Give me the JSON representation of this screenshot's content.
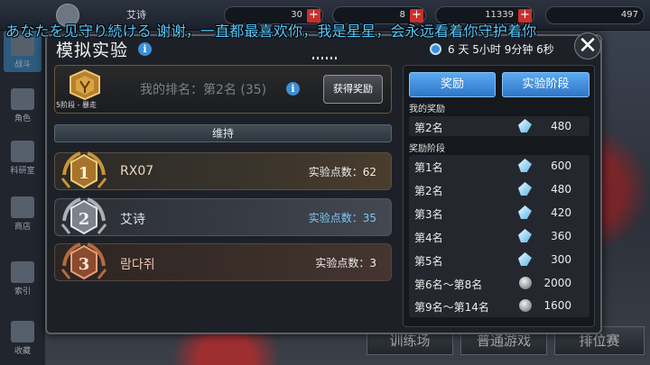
{
  "background": {
    "topbar": {
      "player_name": "艾诗",
      "resource_values": [
        "30",
        "8",
        "11339",
        "497"
      ],
      "plus_label": "+"
    },
    "left_nav": [
      {
        "label": "战斗",
        "icon": "battle-icon"
      },
      {
        "label": "角色",
        "icon": "character-icon"
      },
      {
        "label": "科研室",
        "icon": "research-icon"
      },
      {
        "label": "商店",
        "icon": "shop-icon"
      },
      {
        "label": "索引",
        "icon": "index-icon"
      },
      {
        "label": "收藏",
        "icon": "collection-icon"
      }
    ],
    "bottom_buttons": [
      "训练场",
      "普通游戏",
      "排位赛"
    ]
  },
  "danmaku": "あなたを见守り続ける 谢谢，一直都最喜欢你，我是星星，会永远看着你守护着你",
  "modal": {
    "title": "模拟实验",
    "info_glyph": "i",
    "timer": "6 天 5小时 9分钟 6秒",
    "close_glyph": "✕"
  },
  "my_rank": {
    "stage_label": "5阶段 - 暴走",
    "text": "我的排名：第2名 (35)",
    "claim_button": "获得奖励"
  },
  "status_bar": "维持",
  "leaderboard": [
    {
      "rank": 1,
      "medal": "gold",
      "name": "RX07",
      "points_text": "实验点数：62"
    },
    {
      "rank": 2,
      "medal": "silver",
      "name": "艾诗",
      "points_text": "实验点数：35"
    },
    {
      "rank": 3,
      "medal": "bronze",
      "name": "람다쥐",
      "points_text": "实验点数：3"
    }
  ],
  "right_panel": {
    "tabs": [
      "奖励",
      "实验阶段"
    ],
    "my_reward_label": "我的奖励",
    "my_reward": {
      "name": "第2名",
      "icon": "gem-icon",
      "value": "480"
    },
    "stage_reward_label": "奖励阶段",
    "rewards": [
      {
        "name": "第1名",
        "icon": "gem-icon",
        "value": "600"
      },
      {
        "name": "第2名",
        "icon": "gem-icon",
        "value": "480"
      },
      {
        "name": "第3名",
        "icon": "gem-icon",
        "value": "420"
      },
      {
        "name": "第4名",
        "icon": "gem-icon",
        "value": "360"
      },
      {
        "name": "第5名",
        "icon": "gem-icon",
        "value": "300"
      },
      {
        "name": "第6名～第8名",
        "icon": "coin-icon",
        "value": "2000"
      },
      {
        "name": "第9名～第14名",
        "icon": "coin-icon",
        "value": "1600"
      }
    ]
  },
  "colors": {
    "accent_blue": "#3d8fd8",
    "gold": "#d9a441",
    "silver": "#c9ced4",
    "bronze": "#c3704a",
    "danmaku": "#59c9ff"
  }
}
